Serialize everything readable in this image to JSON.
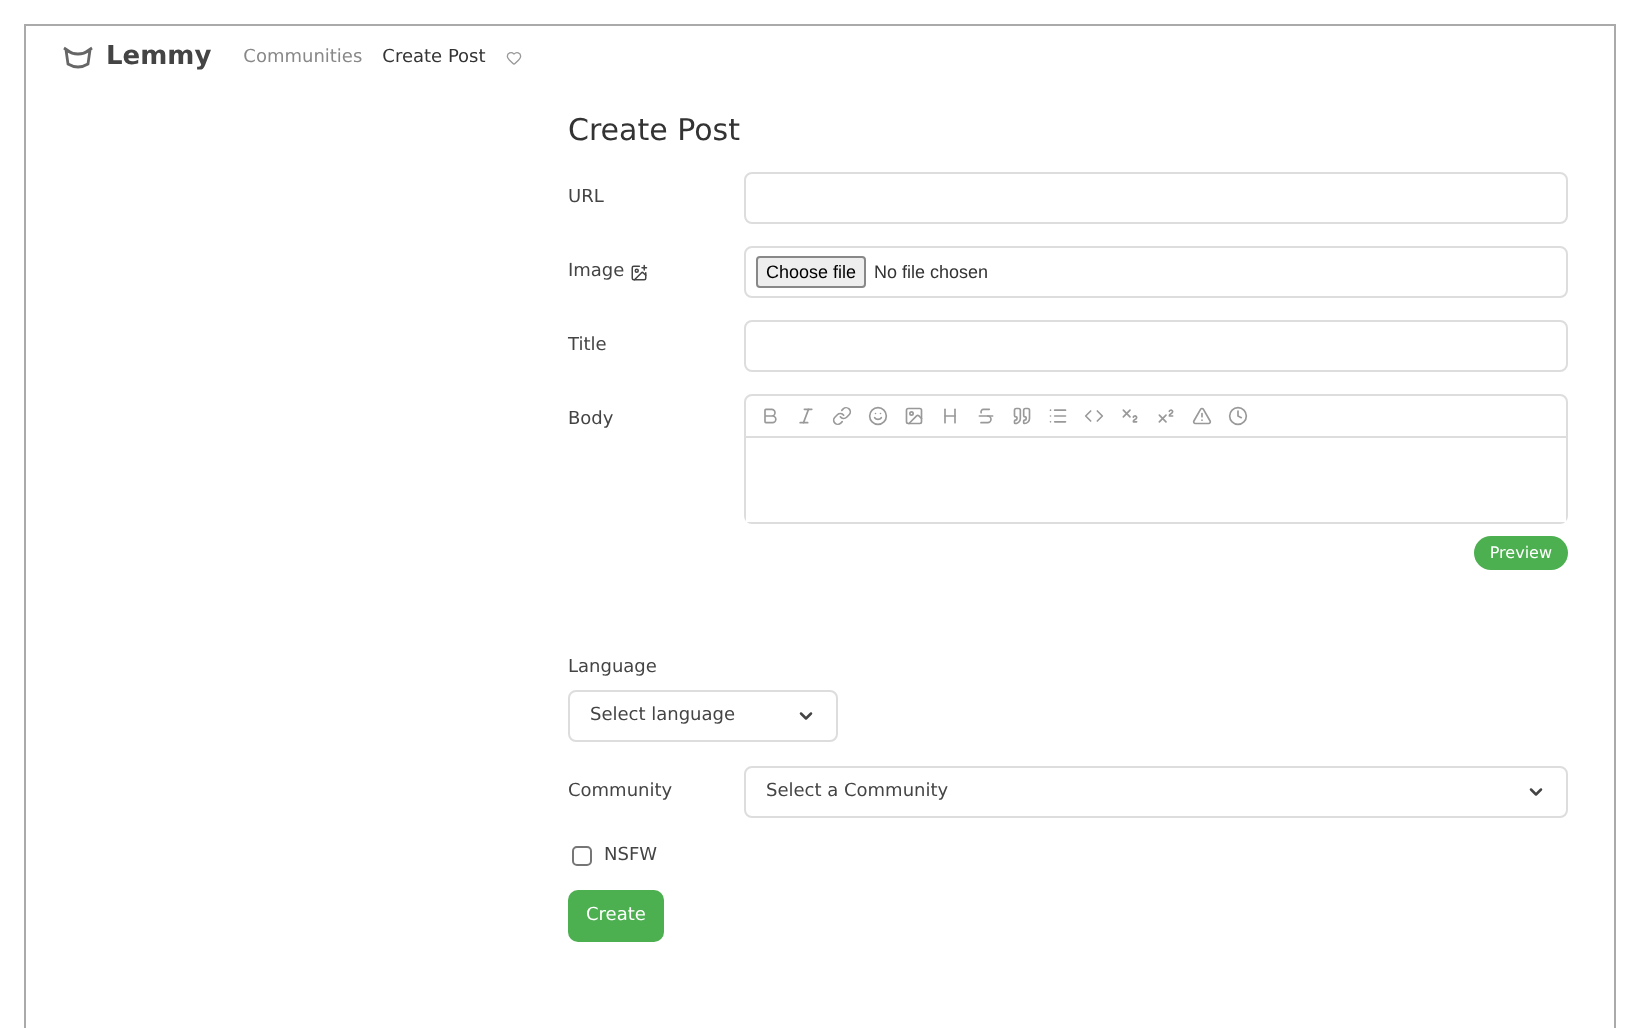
{
  "navbar": {
    "brand": "Lemmy",
    "links": [
      {
        "label": "Communities",
        "selected": false
      },
      {
        "label": "Create Post",
        "selected": true
      }
    ]
  },
  "form": {
    "title": "Create Post",
    "fields": [
      {
        "kind": "text",
        "label": "URL"
      },
      {
        "kind": "file",
        "label": "Image",
        "button": "Choose file",
        "status": "No file chosen"
      },
      {
        "kind": "text",
        "label": "Title"
      },
      {
        "kind": "editor",
        "label": "Body",
        "action": "Preview"
      }
    ],
    "language": {
      "label": "Language",
      "placeholder": "Select language"
    },
    "community": {
      "label": "Community",
      "placeholder": "Select a Community"
    },
    "nsfw": {
      "label": "NSFW",
      "checked": false
    },
    "submit": "Create"
  }
}
